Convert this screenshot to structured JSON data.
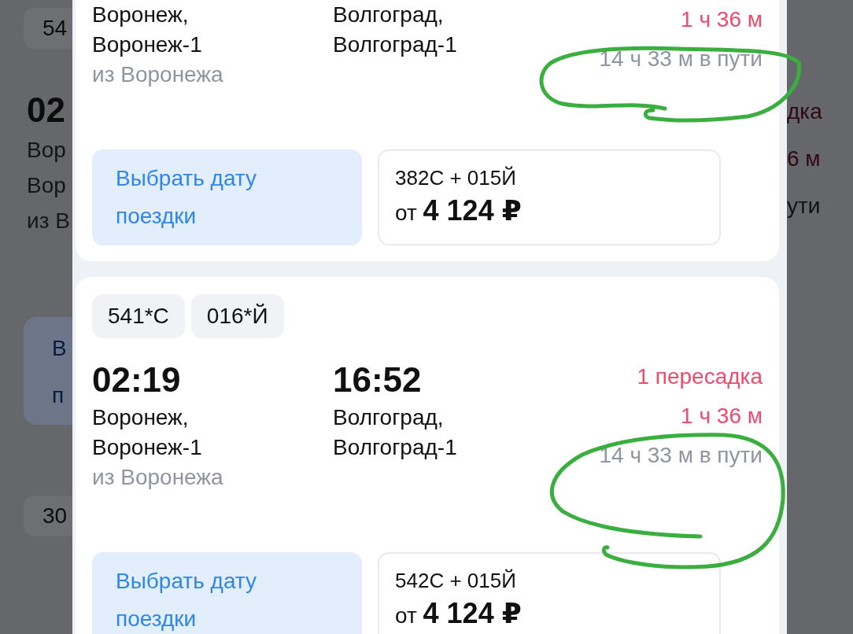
{
  "background_left": [
    {
      "kind": "chip",
      "text": "54"
    },
    {
      "kind": "time",
      "text": "02"
    },
    {
      "kind": "text",
      "text": "Вор"
    },
    {
      "kind": "text",
      "text": "Вор"
    },
    {
      "kind": "muted",
      "text": "из В"
    },
    {
      "kind": "button",
      "lines": [
        "В",
        "п"
      ]
    },
    {
      "kind": "chip",
      "text": "30"
    }
  ],
  "background_right": [
    {
      "kind": "red",
      "text": "дка"
    },
    {
      "kind": "red",
      "text": "6 м"
    },
    {
      "kind": "muted",
      "text": "ути"
    }
  ],
  "trips": [
    {
      "departure": {
        "city": "Воронеж,",
        "station": "Воронеж-1",
        "note": "из Воронежа"
      },
      "arrival": {
        "city": "Волгоград,",
        "station": "Волгоград-1"
      },
      "transfer_time": "1 ч 36 м",
      "duration": "14 ч 33 м в пути",
      "date_button": "Выбрать дату поездки",
      "trains": "382С + 015Й",
      "price": "от **4 124 ₽**"
    },
    {
      "train_tags": [
        "541*С",
        "016*Й"
      ],
      "departure": {
        "time": "02:19",
        "city": "Воронеж,",
        "station": "Воронеж-1",
        "note": "из Воронежа"
      },
      "arrival": {
        "time": "16:52",
        "city": "Волгоград,",
        "station": "Волгоград-1"
      },
      "transfers": "1 пересадка",
      "transfer_time": "1 ч 36 м",
      "duration": "14 ч 33 м в пути",
      "date_button": "Выбрать дату поездки",
      "trains": "542С + 015Й",
      "price": "от **4 124 ₽**"
    }
  ],
  "annotations": [
    {
      "kind": "loop"
    },
    {
      "kind": "loop"
    }
  ]
}
